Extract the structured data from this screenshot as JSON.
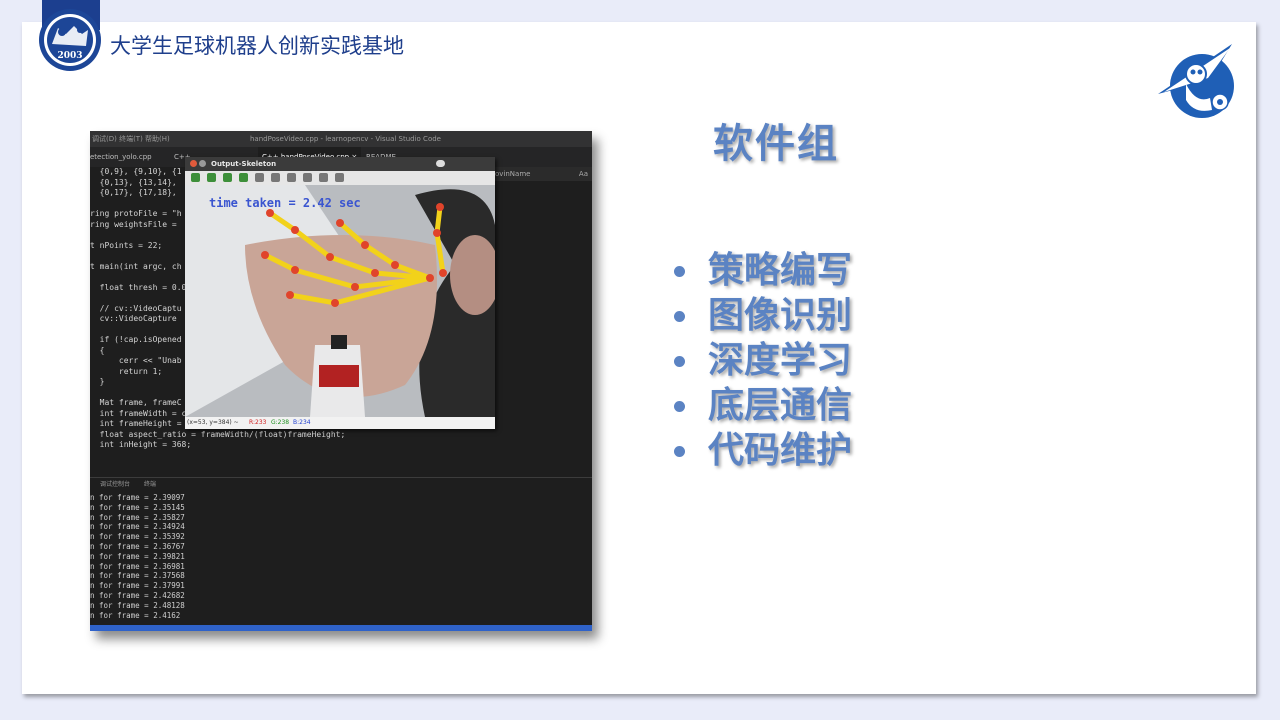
{
  "header": {
    "org_title": "大学生足球机器人创新实践基地",
    "logo_year": "2003"
  },
  "slide": {
    "heading": "软件组",
    "bullets": [
      "策略编写",
      "图像识别",
      "深度学习",
      "底层通信",
      "代码维护"
    ],
    "accent_color": "#5b83c3",
    "header_color": "#1f3f8c"
  },
  "ide": {
    "menu": "调试(D)  终端(T)  帮助(H)",
    "window_title": "handPoseVideo.cpp - learnopencv - Visual Studio Code",
    "tabs": [
      "etection_yolo.cpp",
      "C++ ...",
      "C++ handPoseVideo.cpp ×",
      "README"
    ],
    "panel_label": "ovinName",
    "panel_label2": "Aa",
    "code_lines": [
      "  {0,9}, {9,10}, {1",
      "  {0,13}, {13,14},",
      "  {0,17}, {17,18},",
      "",
      "ring protoFile = \"h",
      "ring weightsFile =",
      "",
      "t nPoints = 22;",
      "",
      "t main(int argc, ch",
      "",
      "  float thresh = 0.0",
      "",
      "  // cv::VideoCaptu",
      "  cv::VideoCapture",
      "",
      "  if (!cap.isOpened",
      "  {",
      "      cerr << \"Unab",
      "      return 1;",
      "  }",
      "",
      "  Mat frame, frameC",
      "  int frameWidth = cap.get(CAP_PROP_FRAME_WIDTH);",
      "  int frameHeight = cap.get(CAP_PROP_FRAME_HEIGHT);",
      "  float aspect_ratio = frameWidth/(float)frameHeight;",
      "  int inHeight = 368;"
    ],
    "terminal_tabs": [
      "调试控制台",
      "终端"
    ],
    "terminal_lines": [
      "n for frame = 2.39097",
      "n for frame = 2.35145",
      "n for frame = 2.35827",
      "n for frame = 2.34924",
      "n for frame = 2.35392",
      "n for frame = 2.36767",
      "n for frame = 2.39821",
      "n for frame = 2.36981",
      "n for frame = 2.37568",
      "n for frame = 2.37991",
      "n for frame = 2.42682",
      "n for frame = 2.48128",
      "n for frame = 2.4162"
    ]
  },
  "opencv_window": {
    "title": "Output-Skeleton",
    "overlay_text": "time taken = 2.42 sec",
    "status_coords": "(x=53, y=384) ~",
    "status_r": "R:233",
    "status_g": "G:238",
    "status_b": "B:234"
  }
}
